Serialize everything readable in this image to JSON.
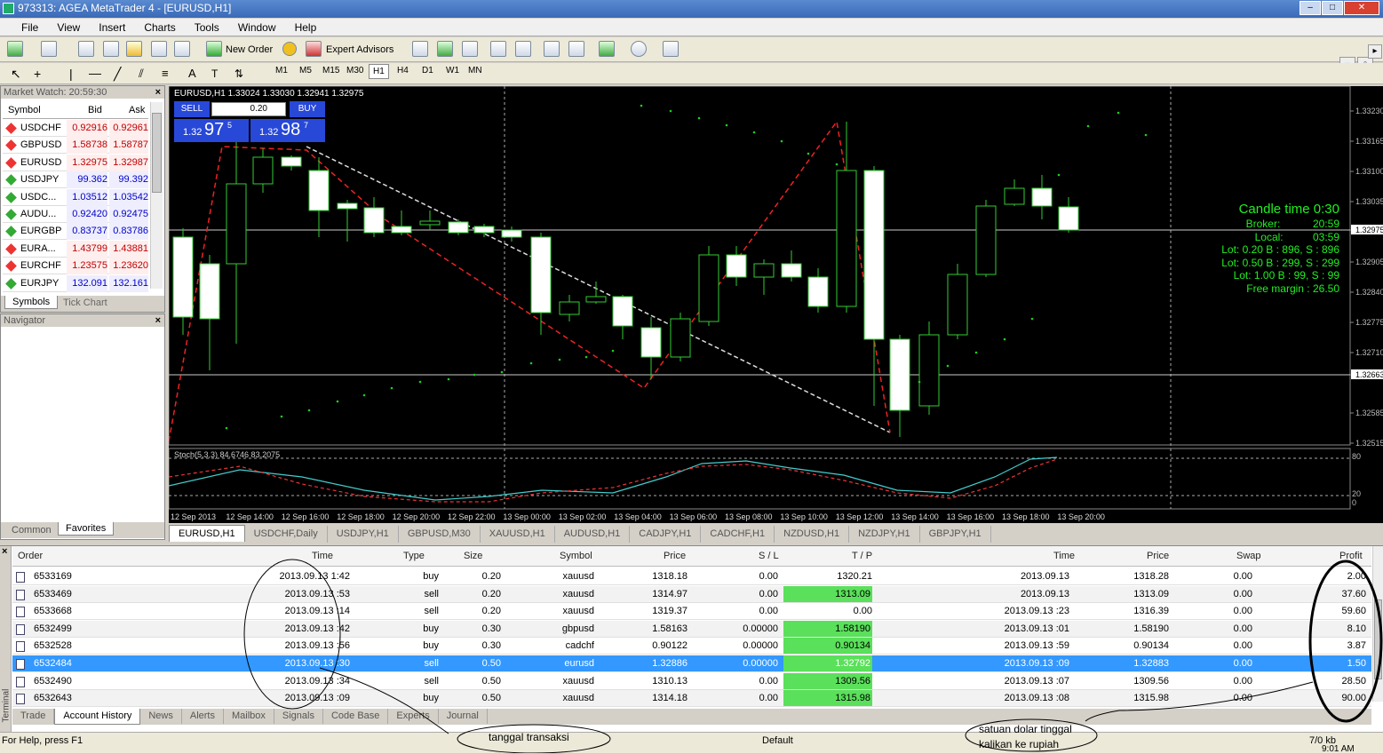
{
  "window": {
    "title": "973313: AGEA MetaTrader 4 - [EURUSD,H1]"
  },
  "menu": [
    "File",
    "View",
    "Insert",
    "Charts",
    "Tools",
    "Window",
    "Help"
  ],
  "toolbar": {
    "new_order": "New Order",
    "expert_advisors": "Expert Advisors",
    "timeframes": [
      "M1",
      "M5",
      "M15",
      "M30",
      "H1",
      "H4",
      "D1",
      "W1",
      "MN"
    ],
    "active_tf": "H1"
  },
  "market_watch": {
    "title": "Market Watch: 20:59:30",
    "col_symbol": "Symbol",
    "col_bid": "Bid",
    "col_ask": "Ask",
    "rows": [
      {
        "sym": "USDCHF",
        "bid": "0.92916",
        "ask": "0.92961",
        "dir": "down"
      },
      {
        "sym": "GBPUSD",
        "bid": "1.58738",
        "ask": "1.58787",
        "dir": "down"
      },
      {
        "sym": "EURUSD",
        "bid": "1.32975",
        "ask": "1.32987",
        "dir": "down"
      },
      {
        "sym": "USDJPY",
        "bid": "99.362",
        "ask": "99.392",
        "dir": "up"
      },
      {
        "sym": "USDC...",
        "bid": "1.03512",
        "ask": "1.03542",
        "dir": "up"
      },
      {
        "sym": "AUDU...",
        "bid": "0.92420",
        "ask": "0.92475",
        "dir": "up"
      },
      {
        "sym": "EURGBP",
        "bid": "0.83737",
        "ask": "0.83786",
        "dir": "up"
      },
      {
        "sym": "EURA...",
        "bid": "1.43799",
        "ask": "1.43881",
        "dir": "down"
      },
      {
        "sym": "EURCHF",
        "bid": "1.23575",
        "ask": "1.23620",
        "dir": "down"
      },
      {
        "sym": "EURJPY",
        "bid": "132.091",
        "ask": "132.161",
        "dir": "up"
      }
    ],
    "tabs": [
      "Symbols",
      "Tick Chart"
    ]
  },
  "navigator": {
    "title": "Navigator",
    "tabs": [
      "Common",
      "Favorites"
    ]
  },
  "chart": {
    "header": "EURUSD,H1  1.33024 1.33030 1.32941 1.32975",
    "sell": "SELL",
    "buy": "BUY",
    "lot": "0.20",
    "sell_big": "97",
    "sell_pre": "1.32",
    "sell_sup": "5",
    "buy_big": "98",
    "buy_pre": "1.32",
    "buy_sup": "7",
    "info": [
      "Candle time 0:30",
      "Broker:           20:59",
      "Local:          03:59",
      "Lot: 0.20 B : 896, S : 896",
      "Lot: 0.50 B : 299, S : 299",
      "Lot: 1.00 B : 99, S : 99",
      "Free margin : 26.50"
    ],
    "prices": [
      "1.33230",
      "1.33165",
      "1.33100",
      "1.33035",
      "1.32975",
      "1.32905",
      "1.32840",
      "1.32775",
      "1.32710",
      "1.32663",
      "1.32585",
      "1.32515"
    ],
    "stoch_label": "Stoch(5,3,3) 84.6746 83.2075",
    "stoch_levels": [
      "80",
      "20",
      "0"
    ],
    "times": [
      "12 Sep 2013",
      "12 Sep 14:00",
      "12 Sep 16:00",
      "12 Sep 18:00",
      "12 Sep 20:00",
      "12 Sep 22:00",
      "13 Sep 00:00",
      "13 Sep 02:00",
      "13 Sep 04:00",
      "13 Sep 06:00",
      "13 Sep 08:00",
      "13 Sep 10:00",
      "13 Sep 12:00",
      "13 Sep 14:00",
      "13 Sep 16:00",
      "13 Sep 18:00",
      "13 Sep 20:00"
    ]
  },
  "chart_tabs": [
    "EURUSD,H1",
    "USDCHF,Daily",
    "USDJPY,H1",
    "GBPUSD,M30",
    "XAUUSD,H1",
    "AUDUSD,H1",
    "CADJPY,H1",
    "CADCHF,H1",
    "NZDUSD,H1",
    "NZDJPY,H1",
    "GBPJPY,H1"
  ],
  "terminal": {
    "headers": {
      "order": "Order",
      "time": "Time",
      "type": "Type",
      "size": "Size",
      "symbol": "Symbol",
      "price": "Price",
      "sl": "S / L",
      "tp": "T / P",
      "time2": "Time",
      "price2": "Price",
      "swap": "Swap",
      "profit": "Profit"
    },
    "rows": [
      {
        "order": "6533169",
        "time": "2013.09.13 1:42",
        "type": "buy",
        "size": "0.20",
        "symbol": "xauusd",
        "price": "1318.18",
        "sl": "0.00",
        "tp": "1320.21",
        "time2": "2013.09.13",
        "price2": "1318.28",
        "swap": "0.00",
        "profit": "2.00",
        "tpg": false
      },
      {
        "order": "6533469",
        "time": "2013.09.13 :53",
        "type": "sell",
        "size": "0.20",
        "symbol": "xauusd",
        "price": "1314.97",
        "sl": "0.00",
        "tp": "1313.09",
        "time2": "2013.09.13",
        "price2": "1313.09",
        "swap": "0.00",
        "profit": "37.60",
        "tpg": true
      },
      {
        "order": "6533668",
        "time": "2013.09.13 :14",
        "type": "sell",
        "size": "0.20",
        "symbol": "xauusd",
        "price": "1319.37",
        "sl": "0.00",
        "tp": "0.00",
        "time2": "2013.09.13 :23",
        "price2": "1316.39",
        "swap": "0.00",
        "profit": "59.60",
        "tpg": false
      },
      {
        "order": "6532499",
        "time": "2013.09.13 :42",
        "type": "buy",
        "size": "0.30",
        "symbol": "gbpusd",
        "price": "1.58163",
        "sl": "0.00000",
        "tp": "1.58190",
        "time2": "2013.09.13 :01",
        "price2": "1.58190",
        "swap": "0.00",
        "profit": "8.10",
        "tpg": true
      },
      {
        "order": "6532528",
        "time": "2013.09.13 :56",
        "type": "buy",
        "size": "0.30",
        "symbol": "cadchf",
        "price": "0.90122",
        "sl": "0.00000",
        "tp": "0.90134",
        "time2": "2013.09.13 :59",
        "price2": "0.90134",
        "swap": "0.00",
        "profit": "3.87",
        "tpg": true
      },
      {
        "order": "6532484",
        "time": "2013.09.13 :30",
        "type": "sell",
        "size": "0.50",
        "symbol": "eurusd",
        "price": "1.32886",
        "sl": "0.00000",
        "tp": "1.32792",
        "time2": "2013.09.13 :09",
        "price2": "1.32883",
        "swap": "0.00",
        "profit": "1.50",
        "tpg": true,
        "sel": true
      },
      {
        "order": "6532490",
        "time": "2013.09.13 :34",
        "type": "sell",
        "size": "0.50",
        "symbol": "xauusd",
        "price": "1310.13",
        "sl": "0.00",
        "tp": "1309.56",
        "time2": "2013.09.13 :07",
        "price2": "1309.56",
        "swap": "0.00",
        "profit": "28.50",
        "tpg": true
      },
      {
        "order": "6532643",
        "time": "2013.09.13 :09",
        "type": "buy",
        "size": "0.50",
        "symbol": "xauusd",
        "price": "1314.18",
        "sl": "0.00",
        "tp": "1315.98",
        "time2": "2013.09.13 :08",
        "price2": "1315.98",
        "swap": "0.00",
        "profit": "90.00",
        "tpg": true
      }
    ],
    "tabs": [
      "Trade",
      "Account History",
      "News",
      "Alerts",
      "Mailbox",
      "Signals",
      "Code Base",
      "Experts",
      "Journal"
    ],
    "active_tab": "Account History",
    "side_label": "Terminal"
  },
  "status": {
    "help": "For Help, press F1",
    "default": "Default",
    "kb": "7/0 kb",
    "clock": "9:01 AM"
  },
  "annotations": {
    "tanggal": "tanggal transaksi",
    "satuan1": "satuan dolar tinggal",
    "satuan2": "kalikan ke rupiah"
  }
}
